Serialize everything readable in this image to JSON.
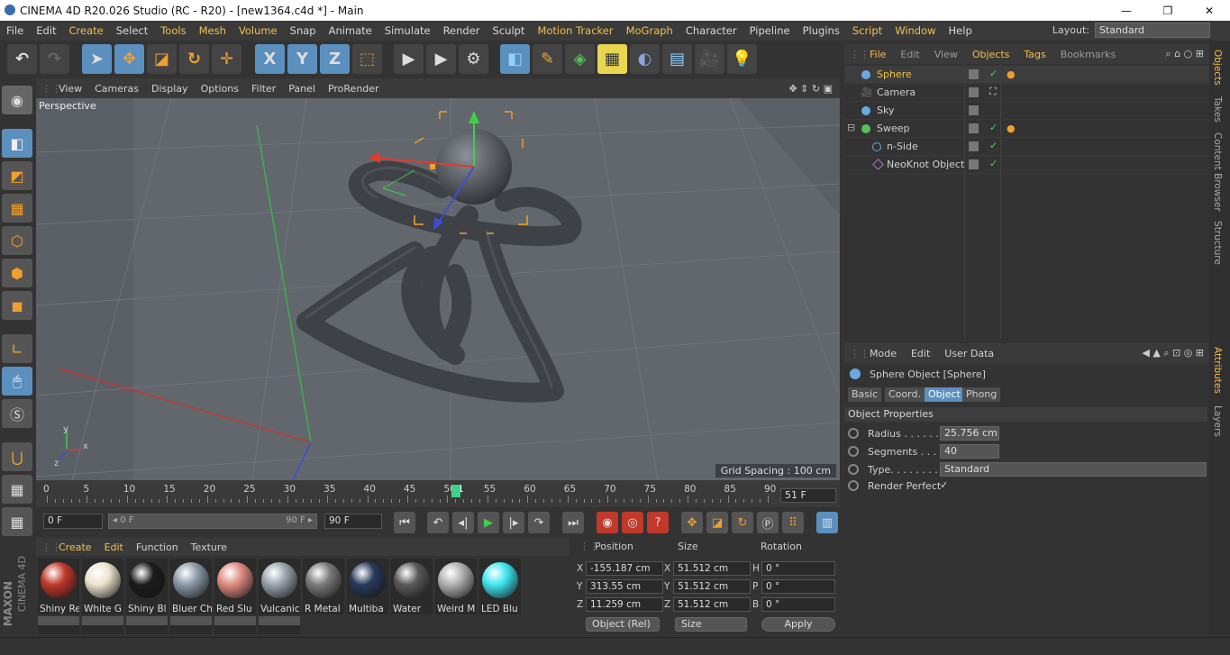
{
  "window": {
    "title": "CINEMA 4D R20.026 Studio (RC - R20) - [new1364.c4d *] - Main",
    "minimize": "—",
    "restore": "❐",
    "close": "✕"
  },
  "menu": [
    "File",
    "Edit",
    "Create",
    "Select",
    "Tools",
    "Mesh",
    "Volume",
    "Snap",
    "Animate",
    "Simulate",
    "Render",
    "Sculpt",
    "Motion Tracker",
    "MoGraph",
    "Character",
    "Pipeline",
    "Plugins",
    "Script",
    "Window",
    "Help"
  ],
  "layout": {
    "label": "Layout:",
    "value": "Standard"
  },
  "toolbar": {
    "x": "X",
    "y": "Y",
    "z": "Z"
  },
  "viewport": {
    "menu": [
      "View",
      "Cameras",
      "Display",
      "Options",
      "Filter",
      "Panel",
      "ProRender"
    ],
    "label": "Perspective",
    "grid_spacing": "Grid Spacing : 100 cm",
    "axis_y": "y",
    "axis_x": "x",
    "axis_z": "z"
  },
  "timeline": {
    "ticks": [
      "0",
      "5",
      "10",
      "15",
      "20",
      "25",
      "30",
      "35",
      "40",
      "45",
      "50",
      "51",
      "55",
      "60",
      "65",
      "70",
      "75",
      "80",
      "85",
      "90"
    ],
    "current": "51 F"
  },
  "transport": {
    "start": "0 F",
    "range_start": "◂ 0 F",
    "range_end": "90 F ▸",
    "end": "90 F"
  },
  "materials": {
    "menu": [
      "Create",
      "Edit",
      "Function",
      "Texture"
    ],
    "items": [
      {
        "name": "Shiny Re",
        "color": "#c0392b"
      },
      {
        "name": "White G",
        "color": "#ede3cf"
      },
      {
        "name": "Shiny Bl",
        "color": "#1c1c1c"
      },
      {
        "name": "Bluer Ch",
        "color": "#8a9aa8"
      },
      {
        "name": "Red Slu",
        "color": "#e08a80"
      },
      {
        "name": "Vulcanic",
        "color": "#9aa3ad"
      },
      {
        "name": "R Metal",
        "color": "#7a7a7a"
      },
      {
        "name": "Multiba",
        "color": "#283a5c"
      },
      {
        "name": "Water",
        "color": "#5a5a5a"
      },
      {
        "name": "Weird M",
        "color": "#b0b0b0"
      },
      {
        "name": "LED Blu",
        "color": "#3fe6f0"
      }
    ]
  },
  "coords": {
    "headers": [
      "Position",
      "Size",
      "Rotation"
    ],
    "rows": [
      {
        "a": "X",
        "pos": "-155.187 cm",
        "sa": "X",
        "size": "51.512 cm",
        "ra": "H",
        "rot": "0 °"
      },
      {
        "a": "Y",
        "pos": "313.55 cm",
        "sa": "Y",
        "size": "51.512 cm",
        "ra": "P",
        "rot": "0 °"
      },
      {
        "a": "Z",
        "pos": "11.259 cm",
        "sa": "Z",
        "size": "51.512 cm",
        "ra": "B",
        "rot": "0 °"
      }
    ],
    "mode": "Object (Rel)",
    "size_mode": "Size",
    "apply": "Apply"
  },
  "objects": {
    "menu": [
      "File",
      "Edit",
      "View",
      "Objects",
      "Tags",
      "Bookmarks"
    ],
    "items": [
      {
        "name": "Sphere",
        "color": "#6aa9e0"
      },
      {
        "name": "Camera",
        "color": "#cccccc"
      },
      {
        "name": "Sky",
        "color": "#6aa9e0"
      },
      {
        "name": "Sweep",
        "color": "#57c05a"
      },
      {
        "name": "n-Side",
        "color": "#6aa9e0"
      },
      {
        "name": "NeoKnot Object",
        "color": "#a57bd6"
      }
    ],
    "check": "✓"
  },
  "side_tabs": [
    "Objects",
    "Takes",
    "Content Browser",
    "Structure",
    "Attributes",
    "Layers"
  ],
  "attributes": {
    "menu": [
      "Mode",
      "Edit",
      "User Data"
    ],
    "object": "Sphere Object [Sphere]",
    "tabs": [
      "Basic",
      "Coord.",
      "Object",
      "Phong"
    ],
    "section": "Object Properties",
    "props": [
      {
        "label": "Radius . . . . . . .",
        "value": "25.756 cm"
      },
      {
        "label": "Segments . . . .",
        "value": "40"
      },
      {
        "label": "Type. . . . . . . . .",
        "value": "Standard"
      },
      {
        "label": "Render Perfect",
        "value": "✓"
      }
    ]
  },
  "brand": {
    "maxon": "MAXON",
    "product": "CINEMA 4D"
  }
}
